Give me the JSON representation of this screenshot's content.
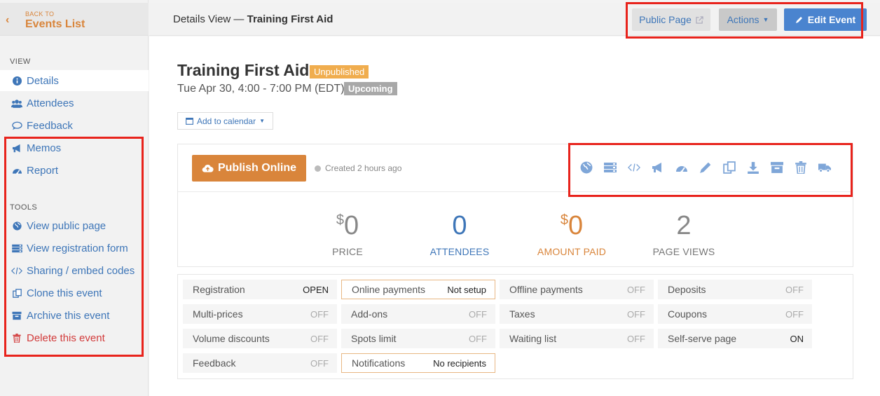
{
  "back": {
    "small": "BACK TO",
    "big": "Events List"
  },
  "sidebar": {
    "view_label": "VIEW",
    "view_items": [
      {
        "label": "Details",
        "icon": "info-icon"
      },
      {
        "label": "Attendees",
        "icon": "users-icon"
      },
      {
        "label": "Feedback",
        "icon": "comment-icon"
      },
      {
        "label": "Memos",
        "icon": "megaphone-icon"
      },
      {
        "label": "Report",
        "icon": "dashboard-icon"
      }
    ],
    "tools_label": "TOOLS",
    "tool_items": [
      {
        "label": "View public page",
        "icon": "globe-icon"
      },
      {
        "label": "View registration form",
        "icon": "form-icon"
      },
      {
        "label": "Sharing / embed codes",
        "icon": "code-icon"
      },
      {
        "label": "Clone this event",
        "icon": "clone-icon"
      },
      {
        "label": "Archive this event",
        "icon": "archive-icon"
      },
      {
        "label": "Delete this event",
        "icon": "trash-icon"
      }
    ]
  },
  "header": {
    "crumb_prefix": "Details View —",
    "crumb_title": "Training First Aid",
    "public_page": "Public Page",
    "actions": "Actions",
    "edit_event": "Edit Event"
  },
  "event": {
    "title": "Training First Aid",
    "status": "Unpublished",
    "datetime": "Tue Apr 30, 4:00 - 7:00 PM (EDT)",
    "timing": "Upcoming",
    "add_calendar": "Add to calendar"
  },
  "panel": {
    "publish": "Publish Online",
    "created": "Created 2 hours ago",
    "stats": [
      {
        "prefix": "$",
        "value": "0",
        "label": "PRICE"
      },
      {
        "prefix": "",
        "value": "0",
        "label": "ATTENDEES"
      },
      {
        "prefix": "$",
        "value": "0",
        "label": "AMOUNT PAID"
      },
      {
        "prefix": "",
        "value": "2",
        "label": "PAGE VIEWS"
      }
    ]
  },
  "settings": [
    {
      "label": "Registration",
      "value": "OPEN"
    },
    {
      "label": "Online payments",
      "value": "Not setup"
    },
    {
      "label": "Offline payments",
      "value": "OFF"
    },
    {
      "label": "Deposits",
      "value": "OFF"
    },
    {
      "label": "Multi-prices",
      "value": "OFF"
    },
    {
      "label": "Add-ons",
      "value": "OFF"
    },
    {
      "label": "Taxes",
      "value": "OFF"
    },
    {
      "label": "Coupons",
      "value": "OFF"
    },
    {
      "label": "Volume discounts",
      "value": "OFF"
    },
    {
      "label": "Spots limit",
      "value": "OFF"
    },
    {
      "label": "Waiting list",
      "value": "OFF"
    },
    {
      "label": "Self-serve page",
      "value": "ON"
    },
    {
      "label": "Feedback",
      "value": "OFF"
    },
    {
      "label": "Notifications",
      "value": "No recipients"
    }
  ],
  "colors": {
    "accent": "#3e76b8",
    "orange": "#d9853b",
    "danger": "#d23b3b",
    "edit": "#4a84cf",
    "highlight": "#e8231c"
  }
}
